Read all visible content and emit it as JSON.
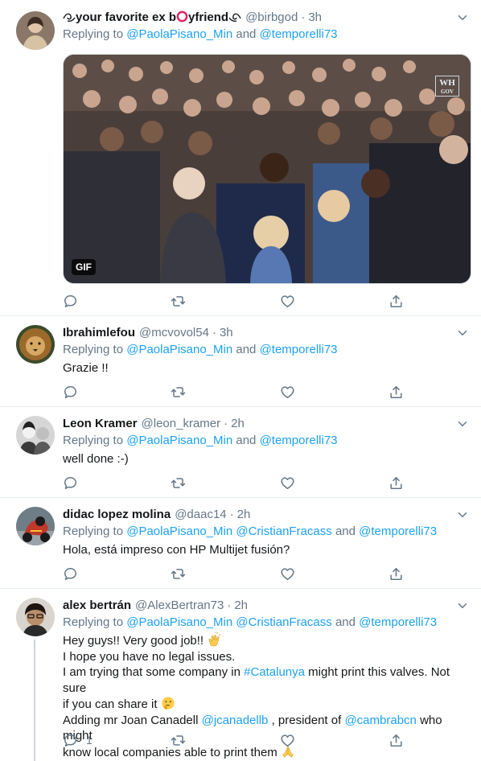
{
  "colors": {
    "link": "#1da1f2",
    "muted": "#657786",
    "border": "#e6ecf0"
  },
  "tweets": [
    {
      "display_name": "✶your favorite ex b⭕yfriend✶",
      "name_parts": {
        "pre": "your favorite ex b",
        "post": "yfriend"
      },
      "handle": "@birbgod",
      "time": "3h",
      "replying_prefix": "Replying to",
      "mentions": [
        "@PaolaPisano_Min",
        "@temporelli73"
      ],
      "joiner": "and",
      "media": {
        "badge": "GIF",
        "watermark_top": "WH",
        "watermark_bottom": "GOV"
      },
      "reply_count": ""
    },
    {
      "display_name": "Ibrahimlefou",
      "handle": "@mcvovol54",
      "time": "3h",
      "replying_prefix": "Replying to",
      "mentions": [
        "@PaolaPisano_Min",
        "@temporelli73"
      ],
      "joiner": "and",
      "text": "Grazie !!"
    },
    {
      "display_name": "Leon Kramer",
      "handle": "@leon_kramer",
      "time": "2h",
      "replying_prefix": "Replying to",
      "mentions": [
        "@PaolaPisano_Min",
        "@temporelli73"
      ],
      "joiner": "and",
      "text": "well done :-)"
    },
    {
      "display_name": "didac lopez molina",
      "handle": "@daac14",
      "time": "2h",
      "replying_prefix": "Replying to",
      "mentions": [
        "@PaolaPisano_Min",
        "@CristianFracass",
        "@temporelli73"
      ],
      "joiner": "and",
      "text": "Hola, está impreso con HP Multijet fusión?"
    },
    {
      "display_name": "alex bertrán",
      "handle": "@AlexBertran73",
      "time": "2h",
      "replying_prefix": "Replying to",
      "mentions": [
        "@PaolaPisano_Min",
        "@CristianFracass",
        "@temporelli73"
      ],
      "joiner": "and",
      "lines": {
        "l1": "Hey guys!! Very good job!!",
        "l2": "I hope you have no legal issues.",
        "l3a": "I am trying that some company in",
        "l3_hashtag": "#Catalunya",
        "l3b": "might print this valves. Not sure",
        "l4": "if you can share it",
        "l5a": "Adding mr Joan Canadell",
        "l5_mention1": "@jcanadellb",
        "l5b": ", president of",
        "l5_mention2": "@cambrabcn",
        "l5c": "who might",
        "l6": "know local companies able to print them"
      },
      "emojis": [
        "clapping-hands",
        "thinking-face",
        "folded-hands"
      ],
      "reply_count": "1"
    }
  ],
  "icons": [
    "reply-icon",
    "retweet-icon",
    "like-icon",
    "share-icon",
    "chevron-down-icon"
  ]
}
